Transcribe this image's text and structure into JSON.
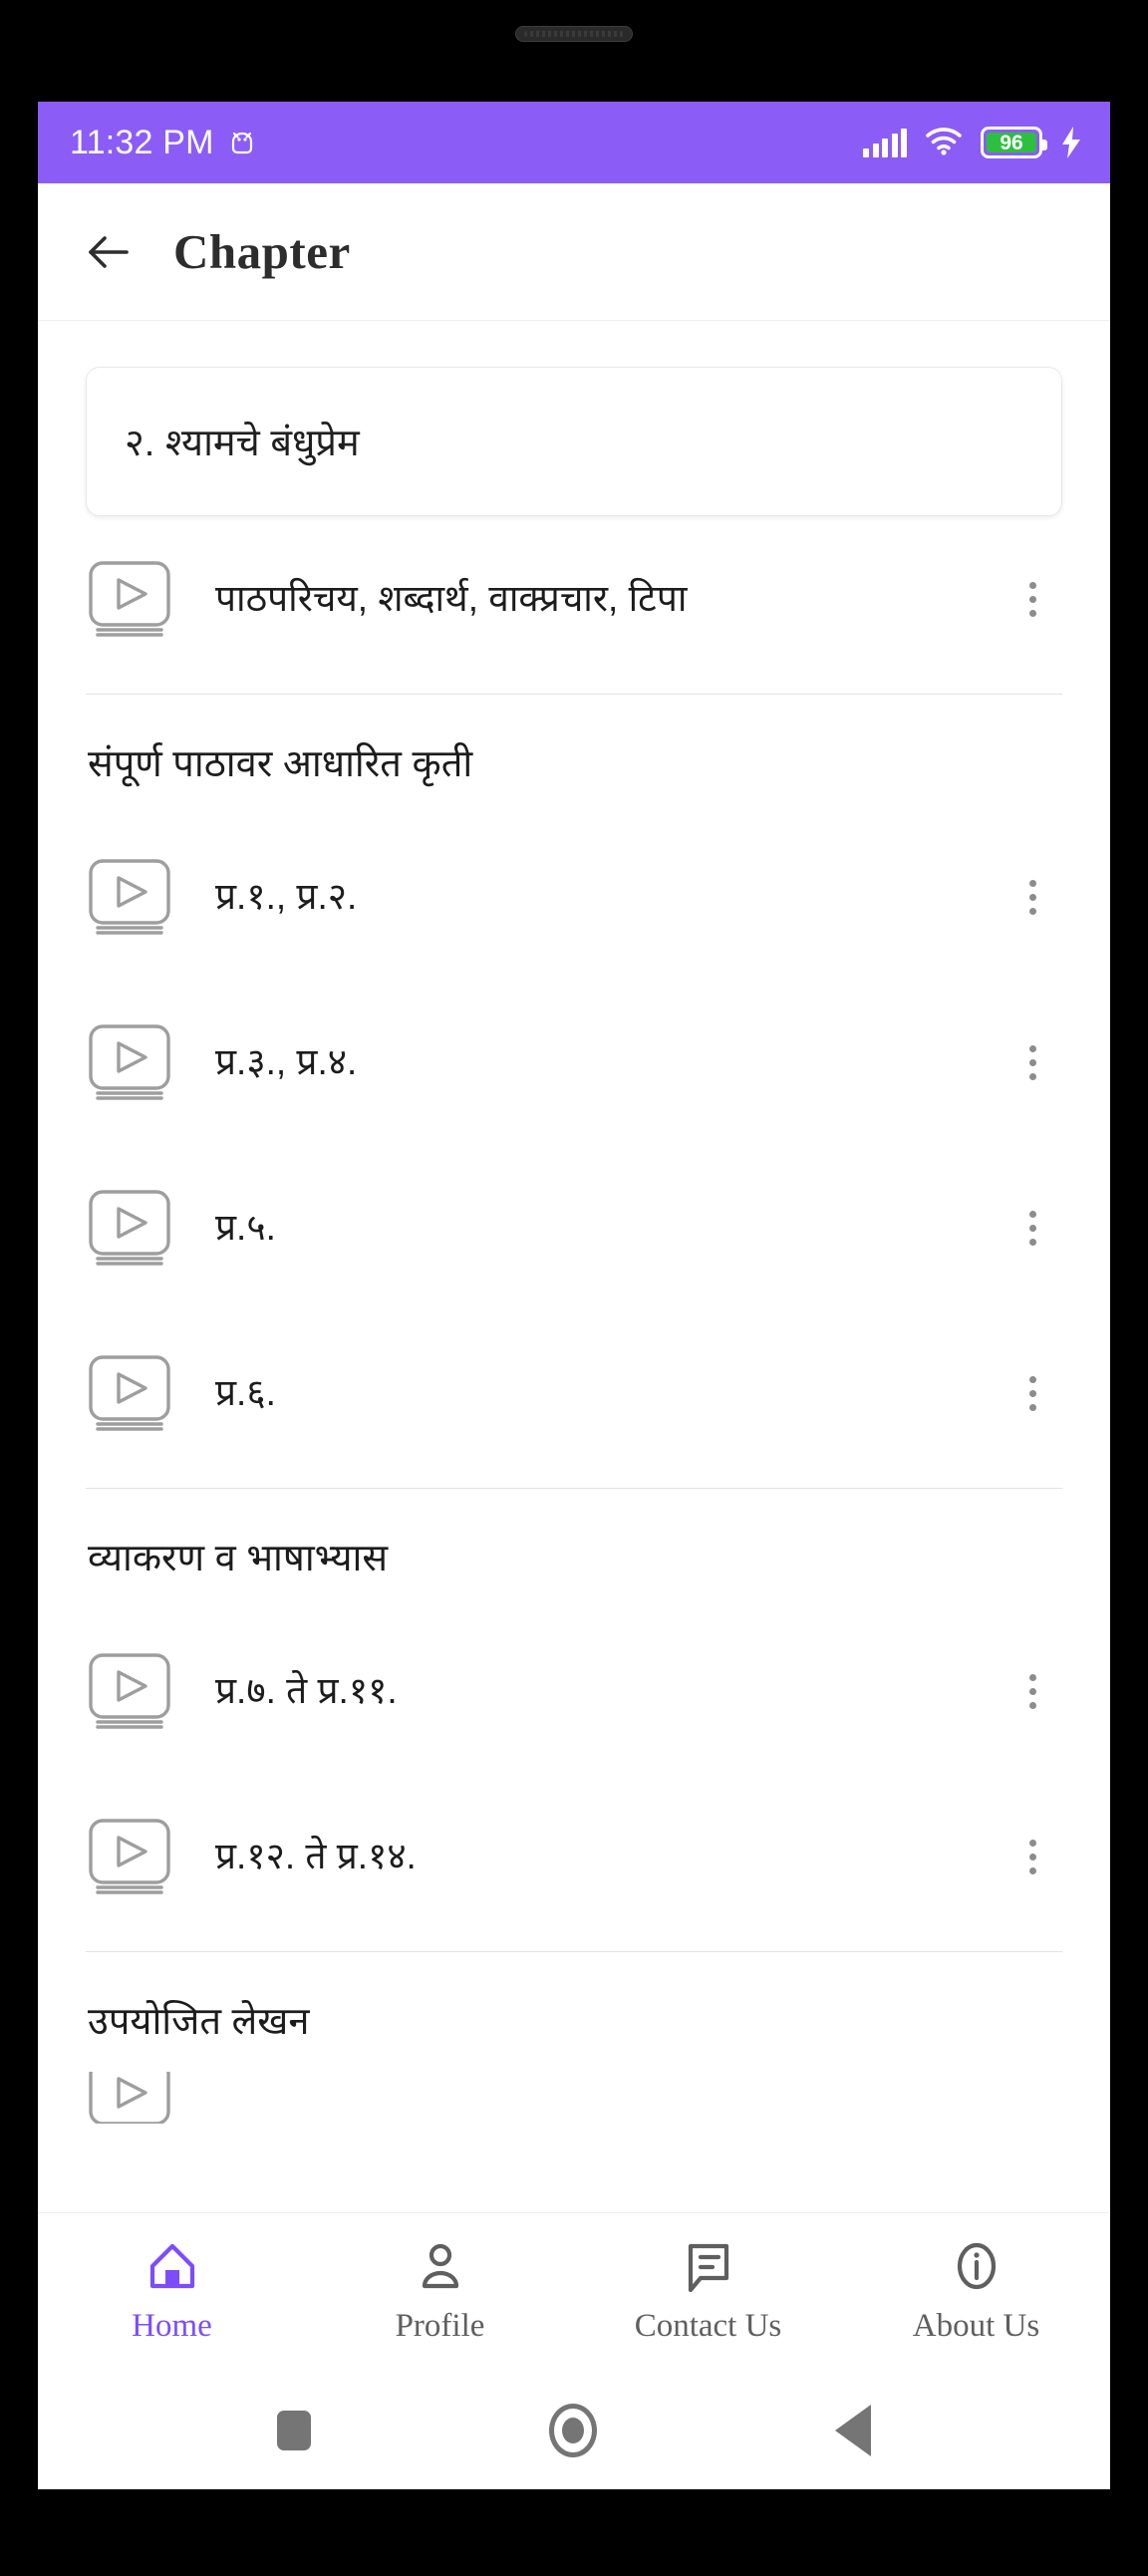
{
  "status_bar": {
    "time": "11:32 PM",
    "android_icon": "android-head-icon",
    "signal_icon": "signal-bars-icon",
    "wifi_icon": "wifi-icon",
    "battery_percent": "96",
    "charging_icon": "charging-bolt-icon",
    "background_color": "#8b5cf6"
  },
  "app_bar": {
    "back_icon": "back-arrow-icon",
    "title": "Chapter"
  },
  "chapter": {
    "title": "२. श्यामचे बंधुप्रेम"
  },
  "intro_items": [
    {
      "label": "पाठपरिचय, शब्दार्थ, वाक्प्रचार, टिपा",
      "icon": "video-play-icon",
      "menu_icon": "kebab-menu-icon"
    }
  ],
  "sections": [
    {
      "heading": "संपूर्ण पाठावर आधारित कृती",
      "items": [
        {
          "label": "प्र.१., प्र.२.",
          "icon": "video-play-icon",
          "menu_icon": "kebab-menu-icon"
        },
        {
          "label": "प्र.३., प्र.४.",
          "icon": "video-play-icon",
          "menu_icon": "kebab-menu-icon"
        },
        {
          "label": "प्र.५.",
          "icon": "video-play-icon",
          "menu_icon": "kebab-menu-icon"
        },
        {
          "label": "प्र.६.",
          "icon": "video-play-icon",
          "menu_icon": "kebab-menu-icon"
        }
      ]
    },
    {
      "heading": "व्याकरण व भाषाभ्यास",
      "items": [
        {
          "label": "प्र.७. ते प्र.११.",
          "icon": "video-play-icon",
          "menu_icon": "kebab-menu-icon"
        },
        {
          "label": "प्र.१२. ते प्र.१४.",
          "icon": "video-play-icon",
          "menu_icon": "kebab-menu-icon"
        }
      ]
    },
    {
      "heading": "उपयोजित लेखन",
      "items": []
    }
  ],
  "bottom_nav": {
    "active_color": "#7c4dff",
    "inactive_color": "#5f5f5f",
    "items": [
      {
        "label": "Home",
        "icon": "home-icon",
        "active": true
      },
      {
        "label": "Profile",
        "icon": "person-icon",
        "active": false
      },
      {
        "label": "Contact Us",
        "icon": "chat-bubble-icon",
        "active": false
      },
      {
        "label": "About Us",
        "icon": "info-circle-icon",
        "active": false
      }
    ]
  },
  "system_nav": {
    "recents_icon": "square-recents-icon",
    "home_icon": "circle-home-icon",
    "back_icon": "triangle-back-icon"
  }
}
